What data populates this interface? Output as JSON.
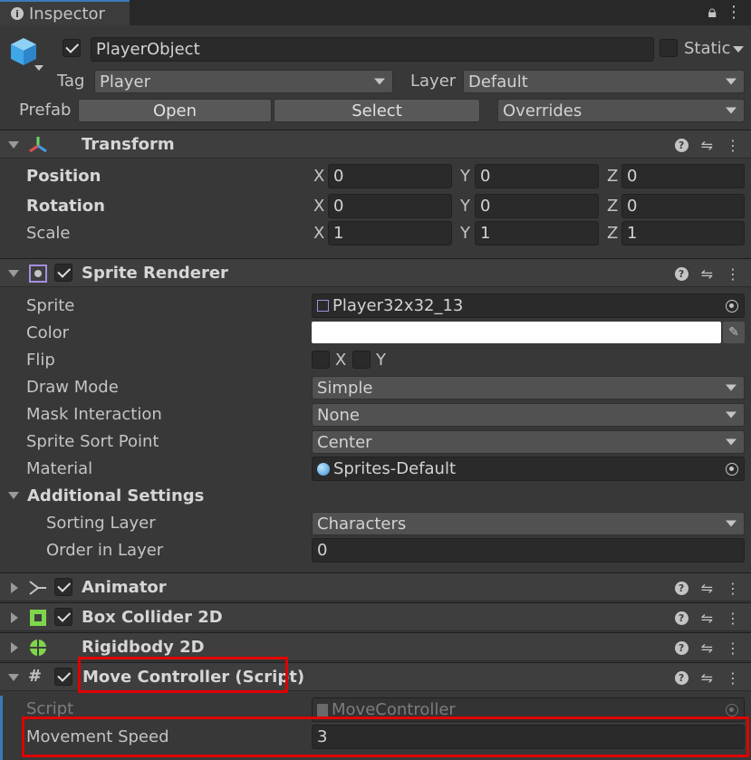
{
  "tab": {
    "title": "Inspector"
  },
  "object": {
    "name": "PlayerObject",
    "static_label": "Static",
    "tag_label": "Tag",
    "tag_value": "Player",
    "layer_label": "Layer",
    "layer_value": "Default",
    "prefab_label": "Prefab",
    "open_label": "Open",
    "select_label": "Select",
    "overrides_label": "Overrides"
  },
  "transform": {
    "title": "Transform",
    "position": {
      "label": "Position",
      "x": "0",
      "y": "0",
      "z": "0"
    },
    "rotation": {
      "label": "Rotation",
      "x": "0",
      "y": "0",
      "z": "0"
    },
    "scale": {
      "label": "Scale",
      "x": "1",
      "y": "1",
      "z": "1"
    },
    "axis": {
      "x": "X",
      "y": "Y",
      "z": "Z"
    }
  },
  "sprite_renderer": {
    "title": "Sprite Renderer",
    "sprite_label": "Sprite",
    "sprite_value": "Player32x32_13",
    "color_label": "Color",
    "color_value": "#ffffff",
    "flip_label": "Flip",
    "flip_x": "X",
    "flip_y": "Y",
    "draw_mode_label": "Draw Mode",
    "draw_mode_value": "Simple",
    "mask_label": "Mask Interaction",
    "mask_value": "None",
    "sort_point_label": "Sprite Sort Point",
    "sort_point_value": "Center",
    "material_label": "Material",
    "material_value": "Sprites-Default",
    "additional_label": "Additional Settings",
    "sorting_layer_label": "Sorting Layer",
    "sorting_layer_value": "Characters",
    "order_label": "Order in Layer",
    "order_value": "0"
  },
  "components": {
    "animator": "Animator",
    "box_collider": "Box Collider 2D",
    "rigidbody": "Rigidbody 2D"
  },
  "move_controller": {
    "title": "Move Controller (Script)",
    "script_label": "Script",
    "script_value": "MoveController",
    "speed_label": "Movement Speed",
    "speed_value": "3"
  },
  "colors": {
    "highlight": "#e00000",
    "accent": "#3a79bb"
  }
}
